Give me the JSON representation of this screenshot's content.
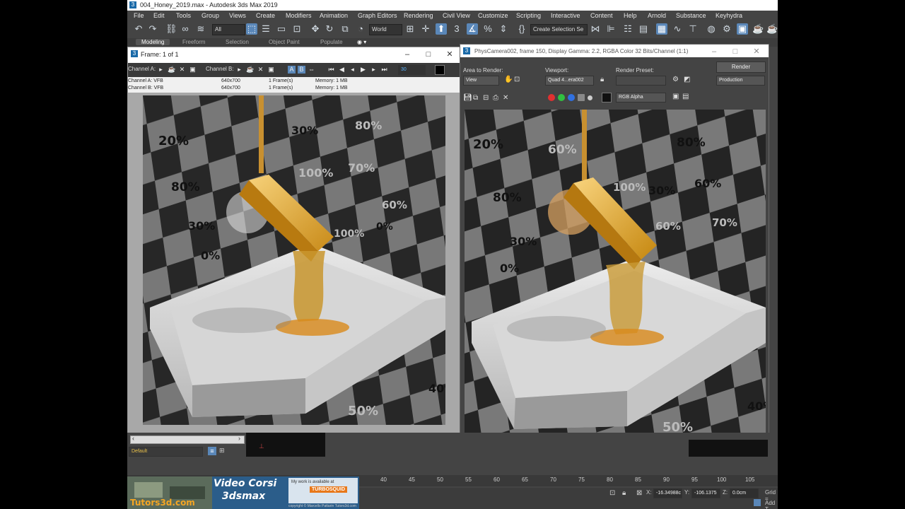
{
  "app": {
    "title": "004_Honey_2019.max - Autodesk 3ds Max 2019",
    "logo_label": "3",
    "menu": [
      "File",
      "Edit",
      "Tools",
      "Group",
      "Views",
      "Create",
      "Modifiers",
      "Animation",
      "Graph Editors",
      "Rendering",
      "Civil View",
      "Customize",
      "Scripting",
      "Interactive",
      "Content",
      "Help",
      "Arnold",
      "Substance",
      "Keyhydra"
    ],
    "toolbar": {
      "ref_coord": "All",
      "coord_system": "World",
      "selection_set": "Create Selection Se"
    },
    "ribbon_tabs": [
      "Modeling",
      "Freeform",
      "Selection",
      "Object Paint",
      "Populate"
    ]
  },
  "ram_player": {
    "title": "Frame: 1 of 1",
    "channel_a_label": "Channel A:",
    "channel_b_label": "Channel B:",
    "ab_a": "A",
    "ab_b": "B",
    "frame_value": "30",
    "info_rows": [
      {
        "channel": "Channel A: VFB",
        "size": "640x700",
        "frames": "1 Frame(s)",
        "memory": "Memory: 1 MB"
      },
      {
        "channel": "Channel B: VFB",
        "size": "640x700",
        "frames": "1 Frame(s)",
        "memory": "Memory: 1 MB"
      }
    ],
    "render_labels": [
      "20%",
      "30%",
      "80%",
      "100%",
      "70%",
      "80%",
      "30%",
      "0%",
      "60%",
      "100%",
      "0%",
      "50%",
      "40%"
    ]
  },
  "render_frame": {
    "title": "PhysCamera002, frame 150, Display Gamma: 2.2, RGBA Color 32 Bits/Channel (1:1)",
    "area_to_render_label": "Area to Render:",
    "area_value": "View",
    "viewport_label": "Viewport:",
    "viewport_value": "Quad 4...era002",
    "preset_label": "Render Preset:",
    "preset_value": "",
    "render_button": "Render",
    "production_value": "Production",
    "channel_value": "RGB Alpha",
    "render_labels": [
      "20%",
      "60%",
      "80%",
      "30%",
      "60%",
      "100%",
      "80%",
      "70%",
      "60%",
      "30%",
      "0%",
      "50%",
      "50%",
      "40%"
    ]
  },
  "bottom": {
    "layer_value": "Default",
    "timeline_ticks": [
      "40",
      "45",
      "50",
      "55",
      "60",
      "65",
      "70",
      "75",
      "80",
      "85",
      "90",
      "95",
      "100",
      "105"
    ],
    "x_label": "X:",
    "x_value": "-16.34988c",
    "y_label": "Y:",
    "y_value": "-106.1375",
    "z_label": "Z:",
    "z_value": "0.0cm",
    "grid_label": "Grid =",
    "add_label": "Add T"
  },
  "promo": {
    "site": "Tutors3d.com",
    "headline_1": "Video Corsi",
    "headline_2": "3dsmax",
    "badge": "TURBOSQUID",
    "tagline": "My work is available at",
    "copyright": "copyright © Marcello Pattarin Tutors3d.com"
  },
  "colors": {
    "accent": "#5a87b8",
    "ui_bg": "#444444",
    "honey": "#d98a1a",
    "gold": "#e8b13c"
  }
}
